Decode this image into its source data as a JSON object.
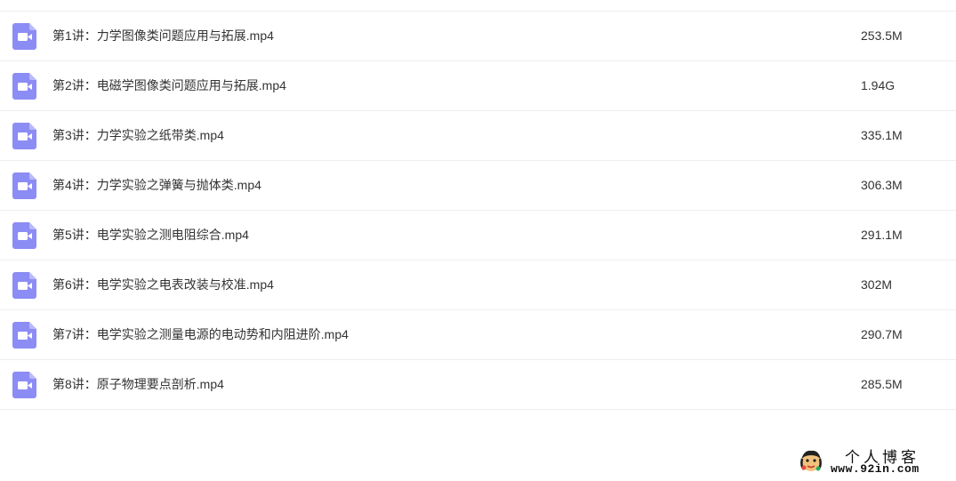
{
  "files": [
    {
      "name": "第1讲：力学图像类问题应用与拓展.mp4",
      "size": "253.5M",
      "icon": "video-file-icon"
    },
    {
      "name": "第2讲：电磁学图像类问题应用与拓展.mp4",
      "size": "1.94G",
      "icon": "video-file-icon"
    },
    {
      "name": "第3讲：力学实验之纸带类.mp4",
      "size": "335.1M",
      "icon": "video-file-icon"
    },
    {
      "name": "第4讲：力学实验之弹簧与抛体类.mp4",
      "size": "306.3M",
      "icon": "video-file-icon"
    },
    {
      "name": "第5讲：电学实验之测电阻综合.mp4",
      "size": "291.1M",
      "icon": "video-file-icon"
    },
    {
      "name": "第6讲：电学实验之电表改装与校准.mp4",
      "size": "302M",
      "icon": "video-file-icon"
    },
    {
      "name": "第7讲：电学实验之测量电源的电动势和内阻进阶.mp4",
      "size": "290.7M",
      "icon": "video-file-icon"
    },
    {
      "name": "第8讲：原子物理要点剖析.mp4",
      "size": "285.5M",
      "icon": "video-file-icon"
    }
  ],
  "watermark": {
    "title": "个人博客",
    "url": "www.92in.com",
    "icon": "blog-logo-icon"
  },
  "colors": {
    "icon_bg": "#8c8cf5",
    "icon_glyph": "#ffffff",
    "row_divider": "#eeeeee",
    "text": "#333333"
  }
}
